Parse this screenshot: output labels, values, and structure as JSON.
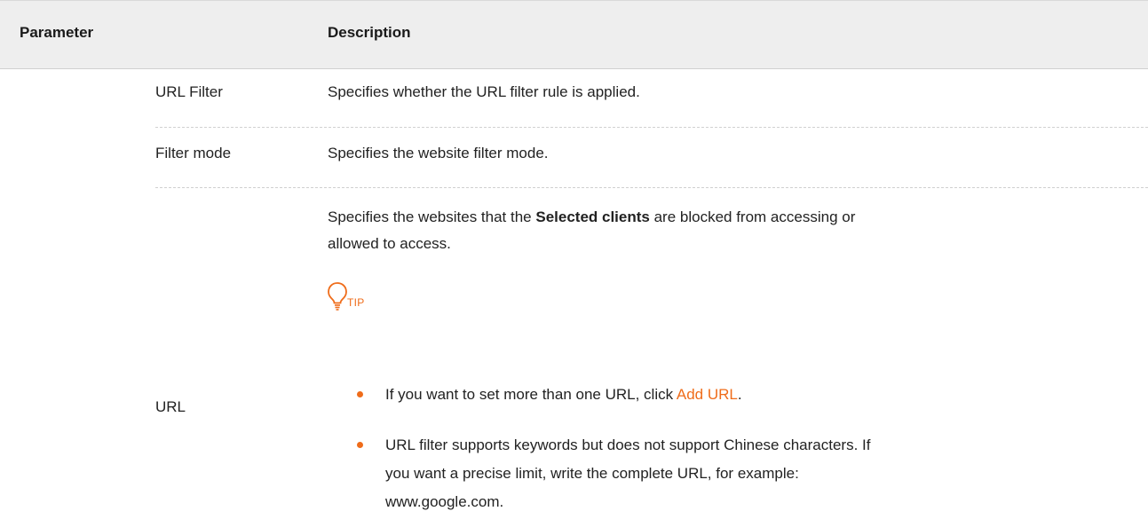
{
  "table": {
    "headers": {
      "parameter": "Parameter",
      "description": "Description"
    },
    "rows": [
      {
        "parameter": "URL Filter",
        "description": "Specifies whether the URL filter rule is applied."
      },
      {
        "parameter": "Filter mode",
        "description": "Specifies the website filter mode."
      },
      {
        "parameter": "URL",
        "description_parts": {
          "before": "Specifies the websites that the ",
          "bold": "Selected clients",
          "after_line1": " are blocked from accessing or",
          "line2": "allowed to access."
        },
        "tip": {
          "label": "TIP",
          "icon": "lightbulb-icon",
          "bullets": [
            {
              "before": "If you want to set more than one URL, click ",
              "link": "Add URL",
              "after": "."
            },
            {
              "line1": "URL filter supports keywords but does not support Chinese characters. If",
              "line2": "you want a precise limit, write the complete URL, for example:",
              "line3": "www.google.com."
            }
          ]
        }
      }
    ]
  },
  "colors": {
    "accent": "#ef6c1a",
    "header_bg": "#eeeeee",
    "text": "#222222"
  }
}
